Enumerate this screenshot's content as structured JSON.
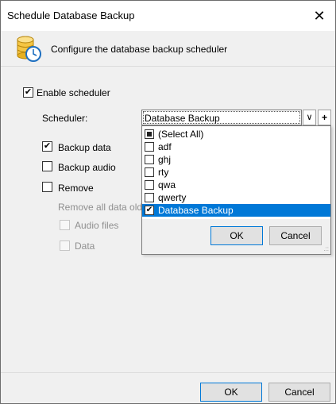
{
  "window": {
    "title": "Schedule Database Backup",
    "close_glyph": "✕"
  },
  "header": {
    "description": "Configure the database backup scheduler",
    "icon": "database-clock-icon"
  },
  "enable_scheduler": {
    "label": "Enable scheduler",
    "checked": true
  },
  "scheduler": {
    "label": "Scheduler:",
    "value": "Database Backup",
    "dropdown_glyph": "∨",
    "add_glyph": "+"
  },
  "options": {
    "backup_data": {
      "label": "Backup data",
      "checked": true
    },
    "backup_audio": {
      "label": "Backup audio",
      "checked": false
    },
    "remove": {
      "label": "Remove",
      "checked": false
    },
    "remove_all_label": "Remove all data olde",
    "audio_files": {
      "label": "Audio files",
      "checked": false
    },
    "data": {
      "label": "Data",
      "checked": false
    }
  },
  "popup": {
    "items": [
      {
        "label": "(Select All)",
        "state": "partial"
      },
      {
        "label": "adf",
        "state": "unchecked"
      },
      {
        "label": "ghj",
        "state": "unchecked"
      },
      {
        "label": "rty",
        "state": "unchecked"
      },
      {
        "label": "qwa",
        "state": "unchecked"
      },
      {
        "label": "qwerty",
        "state": "unchecked"
      },
      {
        "label": "Database Backup",
        "state": "checked"
      }
    ],
    "ok_label": "OK",
    "cancel_label": "Cancel"
  },
  "buttons": {
    "ok_label": "OK",
    "cancel_label": "Cancel"
  },
  "colors": {
    "selection": "#0078d7",
    "dialog_bg": "#f0f0f0"
  }
}
